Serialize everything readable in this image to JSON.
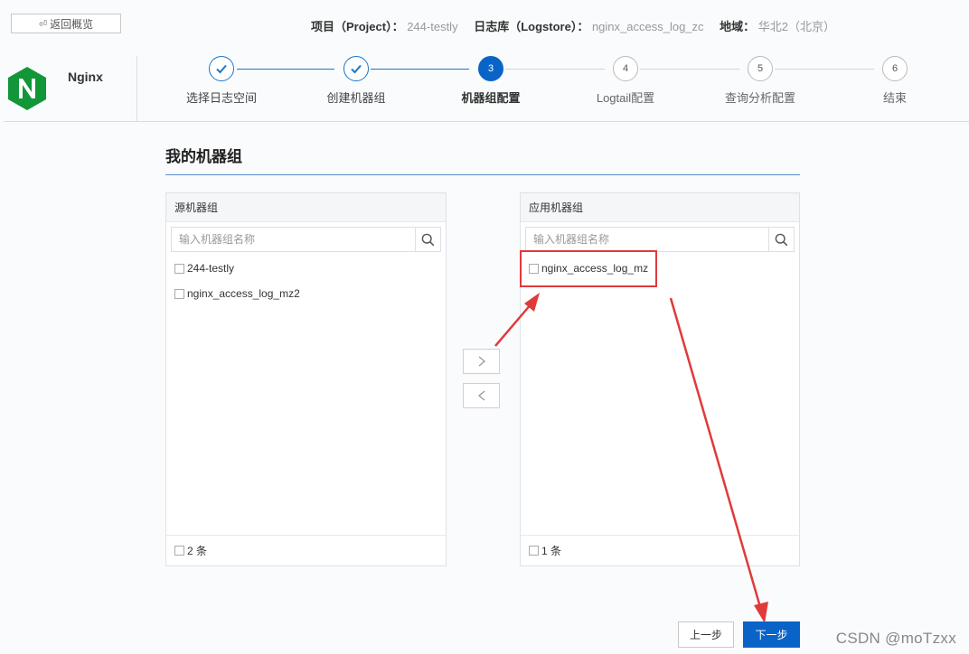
{
  "header": {
    "back_label": "返回概览",
    "project_key": "项目（Project）：",
    "project_val": "244-testly",
    "logstore_key": "日志库（Logstore）：",
    "logstore_val": "nginx_access_log_zc",
    "region_key": "地域：",
    "region_val": "华北2（北京）"
  },
  "app": {
    "name": "Nginx",
    "logo_letter": "N",
    "logo_color": "#119638"
  },
  "steps": [
    {
      "num": "1",
      "label": "选择日志空间",
      "state": "done"
    },
    {
      "num": "2",
      "label": "创建机器组",
      "state": "done"
    },
    {
      "num": "3",
      "label": "机器组配置",
      "state": "active"
    },
    {
      "num": "4",
      "label": "Logtail配置",
      "state": "todo"
    },
    {
      "num": "5",
      "label": "查询分析配置",
      "state": "todo"
    },
    {
      "num": "6",
      "label": "结束",
      "state": "todo"
    }
  ],
  "section_title": "我的机器组",
  "source_panel": {
    "title": "源机器组",
    "search_placeholder": "输入机器组名称",
    "items": [
      "244-testly",
      "nginx_access_log_mz2"
    ],
    "footer": "2 条"
  },
  "target_panel": {
    "title": "应用机器组",
    "search_placeholder": "输入机器组名称",
    "items": [
      "nginx_access_log_mz"
    ],
    "footer": "1 条"
  },
  "transfer": {
    "right_icon": "chevron-right-icon",
    "left_icon": "chevron-left-icon"
  },
  "actions": {
    "prev_label": "上一步",
    "next_label": "下一步"
  },
  "watermark": "CSDN @moTzxx",
  "colors": {
    "primary": "#0a64c8",
    "annotation": "#e03a3a",
    "done": "#1a77c9"
  }
}
